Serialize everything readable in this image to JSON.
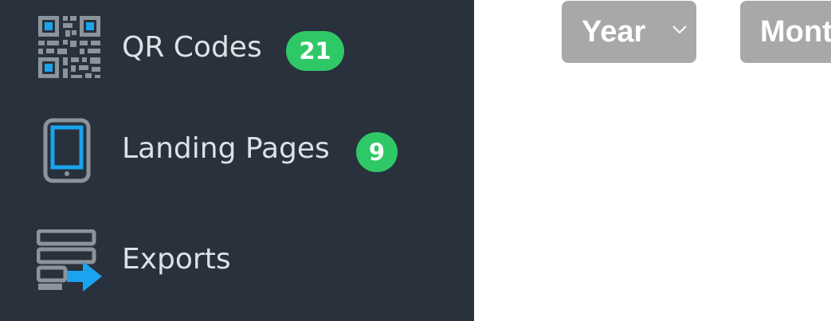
{
  "sidebar": {
    "items": [
      {
        "label": "QR Codes",
        "badge": "21",
        "icon": "qr-code-icon"
      },
      {
        "label": "Landing Pages",
        "badge": "9",
        "icon": "mobile-phone-icon"
      },
      {
        "label": "Exports",
        "icon": "export-icon"
      }
    ]
  },
  "filters": {
    "year_label": "Year",
    "month_label": "Mont"
  },
  "colors": {
    "sidebar_bg": "#28313c",
    "badge_green": "#2ec866",
    "icon_blue": "#1aa3ef",
    "icon_gray": "#8c949b",
    "dropdown_bg": "#a8a8a8"
  }
}
